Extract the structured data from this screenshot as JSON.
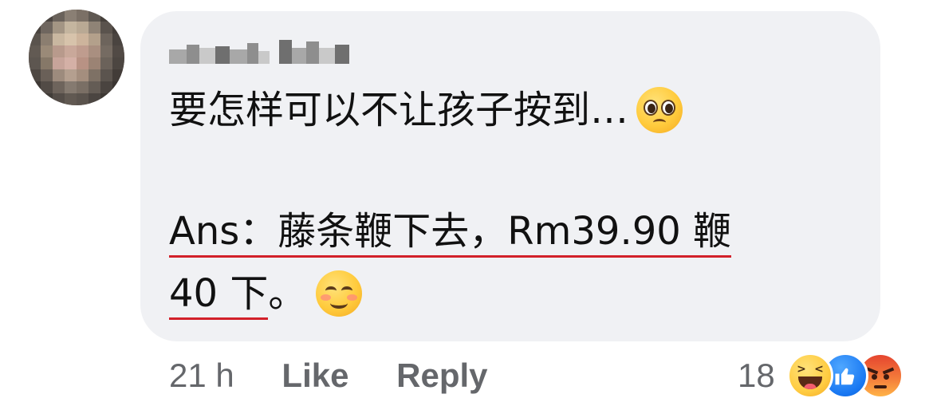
{
  "comment": {
    "line1_text": "要怎样可以不让孩子按到…",
    "line1_emoji": "pleading-face-emoji",
    "line2_text": "Ans：藤条鞭下去，Rm39.90 鞭",
    "line3_text_underlined": "40 下",
    "line3_text_rest": "。",
    "line3_emoji": "smiling-face-emoji"
  },
  "footer": {
    "time": "21 h",
    "like_label": "Like",
    "reply_label": "Reply"
  },
  "reactions": {
    "count": "18",
    "icons": [
      "haha-reaction-icon",
      "like-reaction-icon",
      "angry-reaction-icon"
    ]
  },
  "colors": {
    "bubble": "#f0f1f4",
    "text": "#111111",
    "meta_text": "#65676b",
    "underline": "#d2202a",
    "like_blue": "#1877f2"
  }
}
